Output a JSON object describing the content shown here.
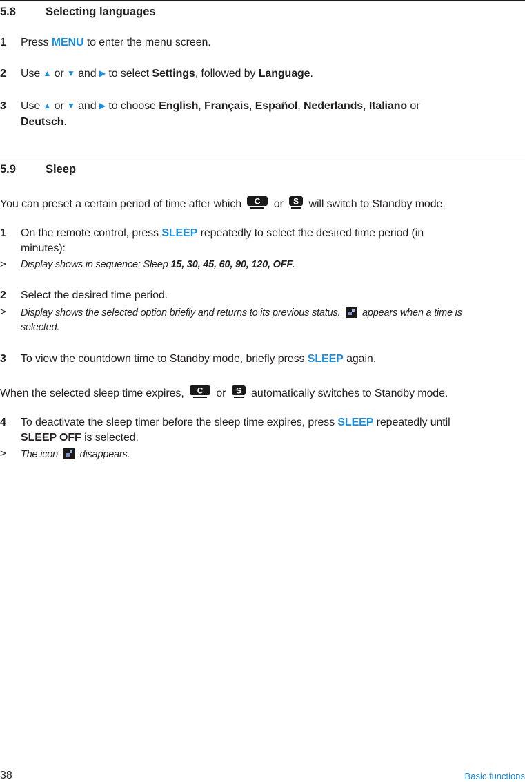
{
  "section_58": {
    "number": "5.8",
    "title": "Selecting languages",
    "steps": [
      {
        "num": "1",
        "pre": "Press ",
        "key": "MENU",
        "post": " to enter the menu screen."
      },
      {
        "num": "2",
        "use": "Use ",
        "or": " or ",
        "and": " and ",
        "to": " to select ",
        "target1": "Settings",
        "mid": ", followed by ",
        "target2": "Language",
        "end": "."
      },
      {
        "num": "3",
        "use": "Use ",
        "or": " or ",
        "and": " and ",
        "to": " to choose ",
        "languages": [
          "English",
          "Français",
          "Español",
          "Nederlands",
          "Italiano",
          "Deutsch"
        ],
        "sep": ", ",
        "or_word": " or ",
        "end": "."
      }
    ],
    "icons": {
      "up": "▲",
      "down": "▼",
      "right": "▶"
    }
  },
  "section_59": {
    "number": "5.9",
    "title": "Sleep",
    "intro_pre": "You can preset a certain period of time after which ",
    "intro_or": " or ",
    "intro_post": " will switch to Standby mode.",
    "device_labels": {
      "c": "C",
      "s": "S"
    },
    "step1_num": "1",
    "step1_pre": "On the remote control, press ",
    "key_sleep": "SLEEP",
    "step1_post": " repeatedly to select the desired time period (in",
    "step1_line2": "minutes):",
    "gt": ">",
    "step1_result_pre": "Display shows in sequence: Sleep ",
    "step1_result_values": "15, 30, 45, 60, 90, 120, OFF",
    "step1_result_end": ".",
    "step2_num": "2",
    "step2_text": "Select the desired time period.",
    "step2_result_pre": "Display shows the selected option briefly and returns to its previous status. ",
    "step2_result_post": " appears when a time is",
    "step2_result_line2": "selected.",
    "step3_num": "3",
    "step3_pre": "To view the countdown time to Standby mode, briefly press ",
    "step3_post": " again.",
    "expire_pre": "When the selected sleep time expires, ",
    "expire_or": " or ",
    "expire_post": " automatically switches to Standby mode.",
    "step4_num": "4",
    "step4_pre": "To deactivate the sleep timer before the sleep time expires, press ",
    "step4_post": " repeatedly until",
    "step4_line2_bold": "SLEEP OFF",
    "step4_line2_post": " is selected.",
    "step4_result_pre": "The icon ",
    "step4_result_post": " disappears."
  },
  "footer": {
    "page_number": "38",
    "section": "Basic functions"
  },
  "colors": {
    "accent": "#1f8dd6",
    "text": "#231f20"
  }
}
